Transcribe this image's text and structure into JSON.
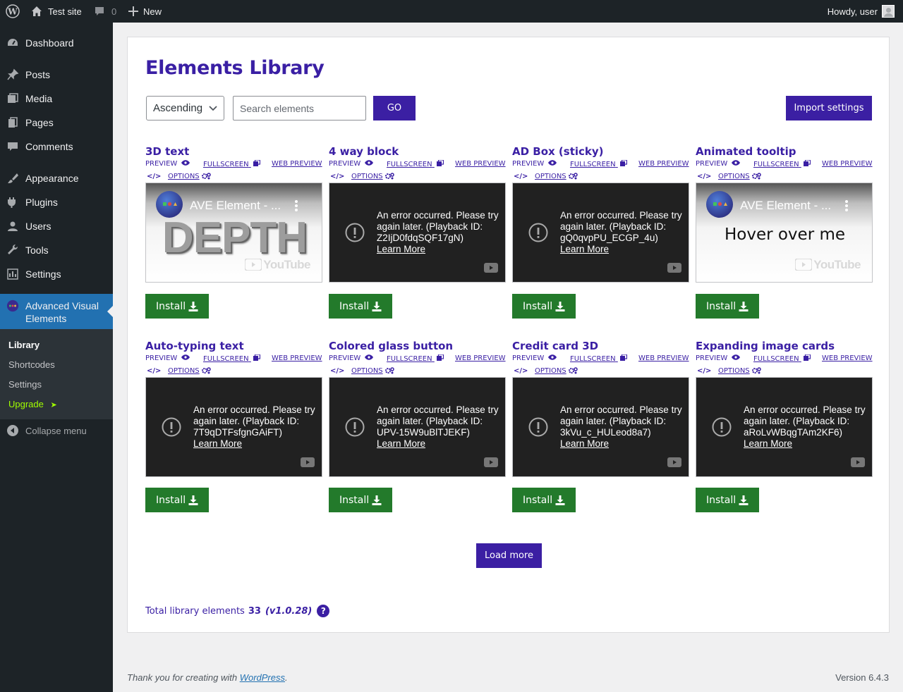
{
  "adminbar": {
    "site_name": "Test site",
    "comments_count": "0",
    "new_label": "New",
    "greeting": "Howdy, user"
  },
  "sidebar": {
    "items": [
      {
        "label": "Dashboard",
        "icon": "dashboard-icon"
      },
      {
        "label": "Posts",
        "icon": "pin-icon"
      },
      {
        "label": "Media",
        "icon": "media-icon"
      },
      {
        "label": "Pages",
        "icon": "pages-icon"
      },
      {
        "label": "Comments",
        "icon": "comment-icon"
      },
      {
        "label": "Appearance",
        "icon": "brush-icon"
      },
      {
        "label": "Plugins",
        "icon": "plugin-icon"
      },
      {
        "label": "Users",
        "icon": "user-icon"
      },
      {
        "label": "Tools",
        "icon": "wrench-icon"
      },
      {
        "label": "Settings",
        "icon": "settings-icon"
      }
    ],
    "active_item": "Advanced Visual Elements",
    "submenu": [
      "Library",
      "Shortcodes",
      "Settings",
      "Upgrade"
    ],
    "upgrade_arrow": "➤",
    "collapse_label": "Collapse menu",
    "upgrade_color": "#a1ff00"
  },
  "page": {
    "title": "Elements Library",
    "sort_value": "Ascending",
    "search_placeholder": "Search elements",
    "go_label": "GO",
    "import_label": "Import settings",
    "load_more_label": "Load more",
    "total_label": "Total library elements",
    "total_count": "33",
    "version": "(v1.0.28)",
    "help_label": "?",
    "accent_color": "#3b1fa3",
    "install_color": "#237a2b"
  },
  "card_labels": {
    "preview": "PREVIEW",
    "fullscreen": "FULLSCREEN",
    "web_preview": "WEB PREVIEW",
    "options": "OPTIONS",
    "install": "Install",
    "code_icon": "</>"
  },
  "cards": [
    {
      "title": "3D text",
      "video": "thumb",
      "thumb_title": "AVE Element - ...",
      "thumb_text": "DEPTH",
      "yt_logo": "YouTube"
    },
    {
      "title": "4 way block",
      "video": "error",
      "error": "An error occurred. Please try again later. (Playback ID: Z2IjD0fdqSQF17gN)",
      "learn_more": "Learn More"
    },
    {
      "title": "AD Box (sticky)",
      "video": "error",
      "error": "An error occurred. Please try again later. (Playback ID: gQ0qvpPU_ECGP_4u)",
      "learn_more": "Learn More"
    },
    {
      "title": "Animated tooltip",
      "video": "thumb",
      "thumb_title": "AVE Element - ...",
      "thumb_text": "Hover over me",
      "yt_logo": "YouTube"
    },
    {
      "title": "Auto-typing text",
      "video": "error",
      "error": "An error occurred. Please try again later. (Playback ID: 7T9qDTFsfgnGAiFT)",
      "learn_more": "Learn More"
    },
    {
      "title": "Colored glass button",
      "video": "error",
      "error": "An error occurred. Please try again later. (Playback ID: UPV-15W9uBlTJEKF)",
      "learn_more": "Learn More"
    },
    {
      "title": "Credit card 3D",
      "video": "error",
      "error": "An error occurred. Please try again later. (Playback ID: 3kVu_c_HULeod8a7)",
      "learn_more": "Learn More"
    },
    {
      "title": "Expanding image cards",
      "video": "error",
      "error": "An error occurred. Please try again later. (Playback ID: aRoLvWBqgTAm2KF6)",
      "learn_more": "Learn More"
    }
  ],
  "footer": {
    "thanks_prefix": "Thank you for creating with",
    "wordpress_link": "WordPress",
    "thanks_suffix": ".",
    "version": "Version 6.4.3"
  }
}
